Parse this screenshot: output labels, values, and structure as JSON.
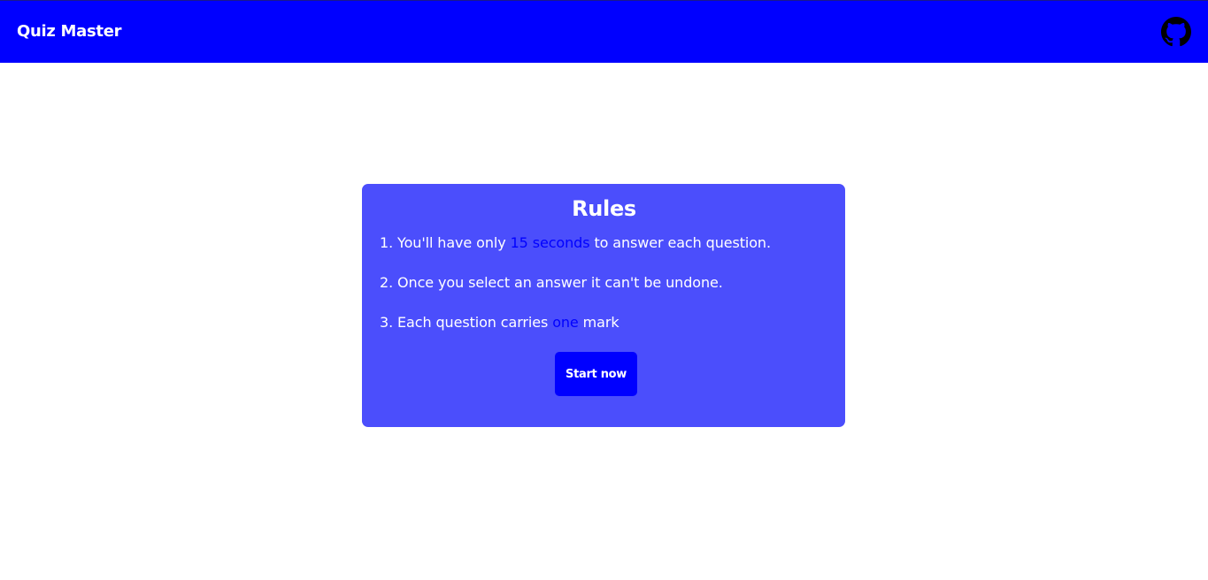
{
  "header": {
    "brand": "Quiz Master",
    "github_icon": "github-icon"
  },
  "rules": {
    "title": "Rules",
    "items": [
      {
        "before": "1. You'll have only ",
        "highlight": "15 seconds",
        "after": " to answer each question."
      },
      {
        "before": "2. Once you select an answer it can't be undone.",
        "highlight": "",
        "after": ""
      },
      {
        "before": "3. Each question carries ",
        "highlight": "one",
        "after": " mark"
      }
    ],
    "start_label": "Start now"
  },
  "colors": {
    "navbar": "#0000ff",
    "card": "#4b4efc",
    "highlight": "#0000ff",
    "button": "#0000ff",
    "text": "#ffffff"
  }
}
